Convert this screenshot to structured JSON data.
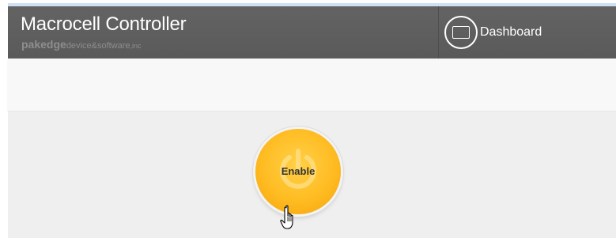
{
  "header": {
    "title": "Macrocell Controller",
    "brand_bold": "pakedge",
    "brand_regular": "device&software",
    "brand_small": ",inc",
    "nav": {
      "dashboard_label": "Dashboard",
      "dashboard_icon": "monitor-icon"
    }
  },
  "main": {
    "enable_button": {
      "label": "Enable",
      "icon": "power-icon"
    }
  },
  "colors": {
    "header_bg": "#5f5f5f",
    "header_text": "#ffffff",
    "brand_text": "#8e8e8e",
    "toolbar_bg": "#f8f8f8",
    "content_bg": "#efefef",
    "enable_button": "#ffbc22"
  }
}
